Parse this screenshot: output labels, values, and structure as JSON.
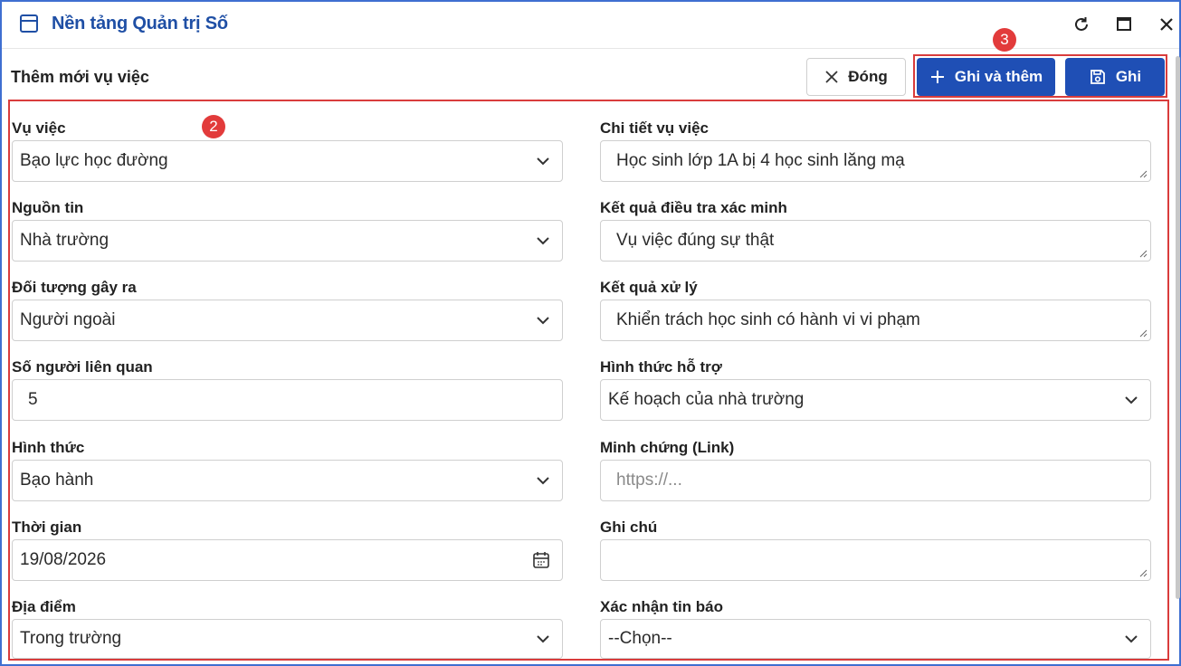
{
  "app": {
    "title": "Nền tảng Quản trị Số"
  },
  "form": {
    "title": "Thêm mới vụ việc"
  },
  "actions": {
    "close_label": "Đóng",
    "save_add_label": "Ghi và thêm",
    "save_label": "Ghi"
  },
  "markers": {
    "form": "2",
    "actions": "3"
  },
  "fields": {
    "vu_viec": {
      "label": "Vụ việc",
      "value": "Bạo lực học đường"
    },
    "chi_tiet": {
      "label": "Chi tiết vụ việc",
      "value": "Học sinh lớp 1A bị 4 học sinh lăng mạ"
    },
    "nguon_tin": {
      "label": "Nguồn tin",
      "value": "Nhà trường"
    },
    "ket_qua_dieu_tra": {
      "label": "Kết quả điều tra xác minh",
      "value": "Vụ việc đúng sự thật"
    },
    "doi_tuong": {
      "label": "Đối tượng gây ra",
      "value": "Người ngoài"
    },
    "ket_qua_xu_ly": {
      "label": "Kết quả xử lý",
      "value": "Khiển trách học sinh có hành vi vi phạm"
    },
    "so_nguoi": {
      "label": "Số người liên quan",
      "value": "5"
    },
    "hinh_thuc_ho_tro": {
      "label": "Hình thức hỗ trợ",
      "value": "Kế hoạch của nhà trường"
    },
    "hinh_thuc": {
      "label": "Hình thức",
      "value": "Bạo hành"
    },
    "minh_chung": {
      "label": "Minh chứng (Link)",
      "placeholder": "https://..."
    },
    "thoi_gian": {
      "label": "Thời gian",
      "value": "19/08/2026"
    },
    "ghi_chu": {
      "label": "Ghi chú",
      "value": ""
    },
    "dia_diem": {
      "label": "Địa điểm",
      "value": "Trong trường"
    },
    "xac_nhan": {
      "label": "Xác nhận tin báo",
      "value": "--Chọn--"
    }
  },
  "colors": {
    "primary": "#1f4fb5",
    "highlight": "#d93c3c",
    "title": "#1f4fa5"
  }
}
